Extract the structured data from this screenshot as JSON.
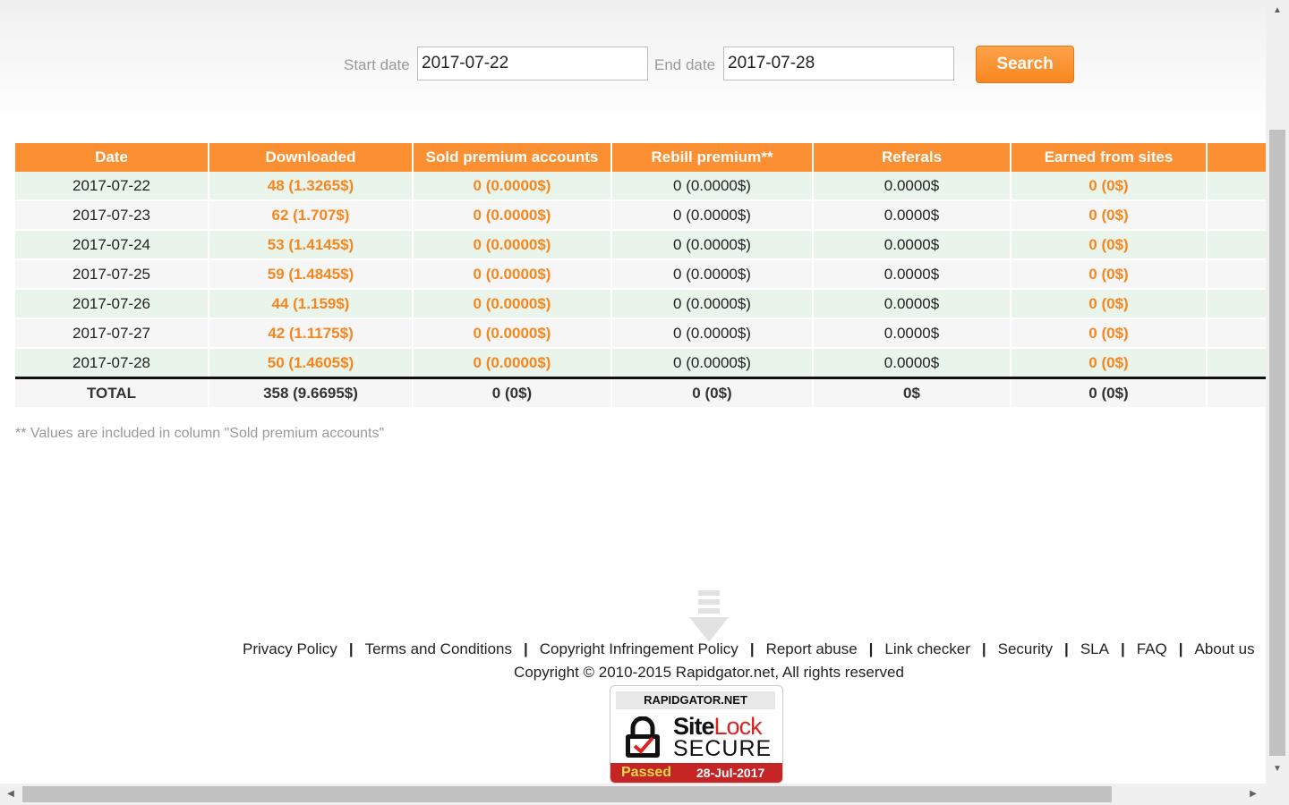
{
  "search": {
    "start_label": "Start date",
    "start_value": "2017-07-22",
    "end_label": "End date",
    "end_value": "2017-07-28",
    "button_label": "Search"
  },
  "table": {
    "headers": [
      "Date",
      "Downloaded",
      "Sold premium accounts",
      "Rebill premium**",
      "Referals",
      "Earned from sites"
    ],
    "rows": [
      {
        "date": "2017-07-22",
        "downloaded": "48 (1.3265$)",
        "sold": "0 (0.0000$)",
        "rebill": "0 (0.0000$)",
        "referals": "0.0000$",
        "earned": "0 (0$)"
      },
      {
        "date": "2017-07-23",
        "downloaded": "62 (1.707$)",
        "sold": "0 (0.0000$)",
        "rebill": "0 (0.0000$)",
        "referals": "0.0000$",
        "earned": "0 (0$)"
      },
      {
        "date": "2017-07-24",
        "downloaded": "53 (1.4145$)",
        "sold": "0 (0.0000$)",
        "rebill": "0 (0.0000$)",
        "referals": "0.0000$",
        "earned": "0 (0$)"
      },
      {
        "date": "2017-07-25",
        "downloaded": "59 (1.4845$)",
        "sold": "0 (0.0000$)",
        "rebill": "0 (0.0000$)",
        "referals": "0.0000$",
        "earned": "0 (0$)"
      },
      {
        "date": "2017-07-26",
        "downloaded": "44 (1.159$)",
        "sold": "0 (0.0000$)",
        "rebill": "0 (0.0000$)",
        "referals": "0.0000$",
        "earned": "0 (0$)"
      },
      {
        "date": "2017-07-27",
        "downloaded": "42 (1.1175$)",
        "sold": "0 (0.0000$)",
        "rebill": "0 (0.0000$)",
        "referals": "0.0000$",
        "earned": "0 (0$)"
      },
      {
        "date": "2017-07-28",
        "downloaded": "50 (1.4605$)",
        "sold": "0 (0.0000$)",
        "rebill": "0 (0.0000$)",
        "referals": "0.0000$",
        "earned": "0 (0$)"
      }
    ],
    "total": {
      "label": "TOTAL",
      "downloaded": "358 (9.6695$)",
      "sold": "0 (0$)",
      "rebill": "0 (0$)",
      "referals": "0$",
      "earned": "0 (0$)"
    }
  },
  "footnote": "** Values are included in column \"Sold premium accounts\"",
  "footer": {
    "links": [
      "Privacy Policy",
      "Terms and Conditions",
      "Copyright Infringement Policy",
      "Report abuse",
      "Link checker",
      "Security",
      "SLA",
      "FAQ",
      "About us"
    ],
    "copyright": "Copyright © 2010-2015 Rapidgator.net, All rights reserved"
  },
  "sitelock": {
    "domain": "RAPIDGATOR.NET",
    "brand_site": "Site",
    "brand_lock": "Lock",
    "secure": "SECURE",
    "passed": "Passed",
    "date": "28-Jul-2017"
  },
  "icons": {
    "download_watermark": "download-arrow-icon",
    "lock": "padlock-check-icon",
    "scroll_up": "scroll-up-arrow-icon",
    "scroll_down": "scroll-down-arrow-icon",
    "scroll_left": "scroll-left-arrow-icon",
    "scroll_right": "scroll-right-arrow-icon"
  },
  "colors": {
    "accent": "#fb8f31",
    "orange_text": "#f7861f",
    "row_green": "#e9f4eb",
    "row_gray": "#f6f6f6"
  }
}
